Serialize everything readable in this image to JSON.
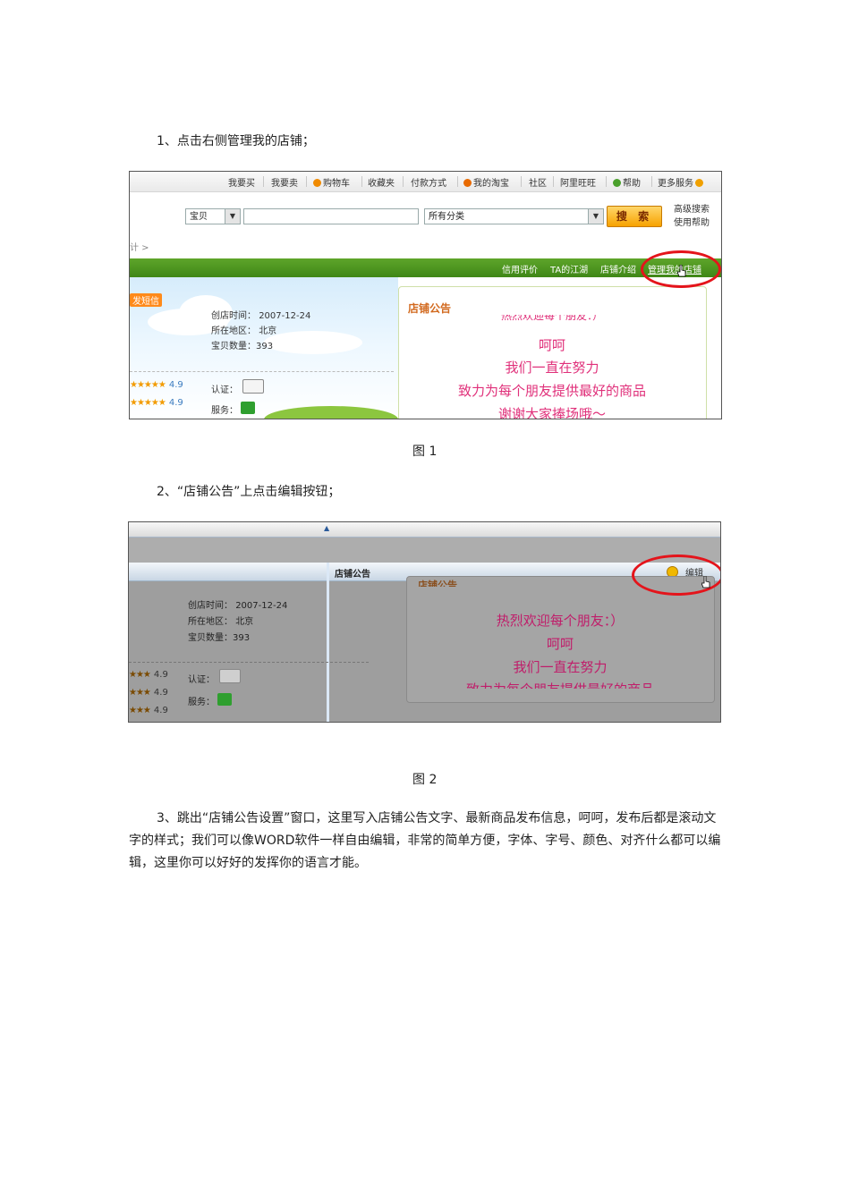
{
  "step1": {
    "text": "1、点击右侧管理我的店铺；"
  },
  "step2": {
    "text": "2、“店铺公告”上点击编辑按钮；"
  },
  "step3": {
    "text": "3、跳出“店铺公告设置”窗口，这里写入店铺公告文字、最新商品发布信息，呵呵，发布后都是滚动文字的样式；我们可以像WORD软件一样自由编辑，非常的简单方便，字体、字号、颜色、对齐什么都可以编辑，这里你可以好好的发挥你的语言才能。"
  },
  "fig1": {
    "caption": "图 1",
    "topnav": [
      "我要买",
      "我要卖",
      "购物车",
      "收藏夹",
      "付款方式",
      "我的淘宝",
      "社区",
      "阿里旺旺",
      "帮助",
      "更多服务"
    ],
    "search": {
      "type_value": "宝贝",
      "query_value": "",
      "category_value": "所有分类",
      "button": "搜 索",
      "advanced": "高级搜索",
      "help": "使用帮助"
    },
    "crumb": "计 >",
    "greenbar": [
      "信用评价",
      "TA的江湖",
      "店铺介绍",
      "管理我的店铺"
    ],
    "sms_badge": "发短信",
    "shop_info": {
      "created_label": "创店时间：",
      "created": "2007-12-24",
      "region_label": "所在地区：",
      "region": "北京",
      "count_label": "宝贝数量：",
      "count": "393"
    },
    "ratings": [
      "4.9",
      "4.9"
    ],
    "cert_label": "认证：",
    "service_label": "服务：",
    "notice_title": "店铺公告",
    "notice_lines": [
      "热烈欢迎每个朋友：）",
      "呵呵",
      "我们一直在努力",
      "致力为每个朋友提供最好的商品",
      "谢谢大家捧场哦～"
    ]
  },
  "fig2": {
    "caption": "图 2",
    "header_title": "店铺公告",
    "edit_label": "编辑",
    "notice_title": "店铺公告",
    "shop_info": {
      "created_label": "创店时间：",
      "created": "2007-12-24",
      "region_label": "所在地区：",
      "region": "北京",
      "count_label": "宝贝数量：",
      "count": "393"
    },
    "ratings": [
      "4.9",
      "4.9",
      "4.9"
    ],
    "cert_label": "认证：",
    "service_label": "服务：",
    "notice_lines": [
      "热烈欢迎每个朋友：）",
      "呵呵",
      "我们一直在努力",
      "致力为每个朋友提供最好的商品"
    ]
  },
  "colors": {
    "green_bar": "#4a9520",
    "highlight_ring": "#e4141b",
    "notice_text": "#e0307a",
    "notice_title": "#d2691e",
    "search_button": "#f7a200"
  }
}
